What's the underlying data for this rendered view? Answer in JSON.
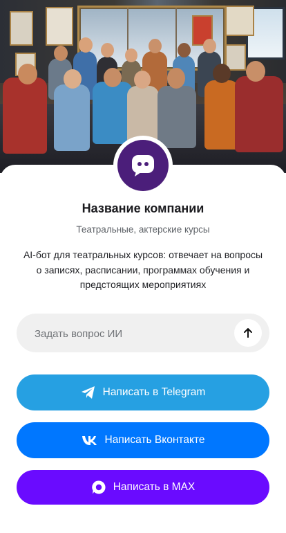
{
  "hero": {
    "image_description_icon": "theater-group-photo"
  },
  "profile": {
    "avatar_icon": "chat-bot-icon",
    "company_name": "Название компании",
    "subtitle": "Театральные, актерские курсы",
    "description": "AI-бот для театральных курсов: отвечает на вопросы о записях, расписании, программах обучения и предстоящих мероприятиях"
  },
  "ask": {
    "placeholder": "Задать вопрос ИИ",
    "value": "",
    "send_icon": "arrow-up-icon"
  },
  "buttons": {
    "telegram": {
      "label": "Написать в Telegram",
      "icon": "telegram-icon",
      "color": "#26a0e2"
    },
    "vk": {
      "label": "Написать Вконтакте",
      "icon": "vk-icon",
      "color": "#0077ff"
    },
    "max": {
      "label": "Написать в MAX",
      "icon": "max-icon",
      "color": "#6a0bff"
    }
  },
  "colors": {
    "avatar_bg": "#4b1e7a",
    "text_primary": "#1b1b1f",
    "text_secondary": "#5f6368",
    "input_bg": "#f0f0f0"
  }
}
